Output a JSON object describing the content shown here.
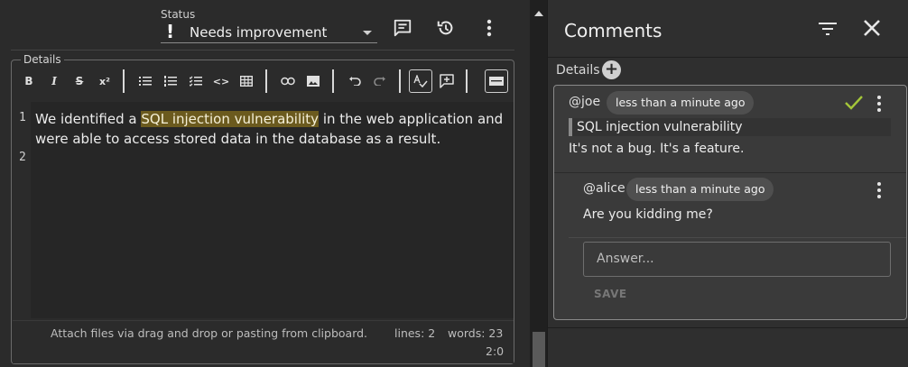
{
  "status": {
    "label": "Status",
    "value": "Needs improvement",
    "indicator": "!"
  },
  "top_actions": [
    {
      "name": "comment-icon"
    },
    {
      "name": "history-icon"
    },
    {
      "name": "more-vert-icon"
    }
  ],
  "details": {
    "legend": "Details",
    "toolbar": {
      "bold": "B",
      "italic": "I",
      "strike": "S",
      "superscript": "x²",
      "code": "<>"
    },
    "editor": {
      "line_numbers": [
        "1",
        "2"
      ],
      "line1_before": "We identified a ",
      "line1_highlight": "SQL injection vulnerability",
      "line1_after": " in the web application and were able to access stored data in the database as a result."
    },
    "statusbar": {
      "attach": "Attach files via drag and drop or pasting from clipboard.",
      "lines": "lines: 2",
      "words": "words: 23",
      "cursor": "2:0"
    }
  },
  "comments": {
    "title": "Comments",
    "section_label": "Details",
    "thread": {
      "author": "@joe",
      "time": "less than a minute ago",
      "quote": "SQL injection vulnerability",
      "text": "It's not a bug. It's a feature.",
      "resolved_color": "#a4c639",
      "reply": {
        "author": "@alice",
        "time": "less than a minute ago",
        "text": "Are you kidding me?"
      },
      "answer_placeholder": "Answer...",
      "save_label": "SAVE"
    }
  },
  "colors": {
    "background": "#2b2b2b",
    "panel": "#2f2f2f",
    "highlight": "#6b5a1e",
    "chip": "#4f4f4f"
  }
}
